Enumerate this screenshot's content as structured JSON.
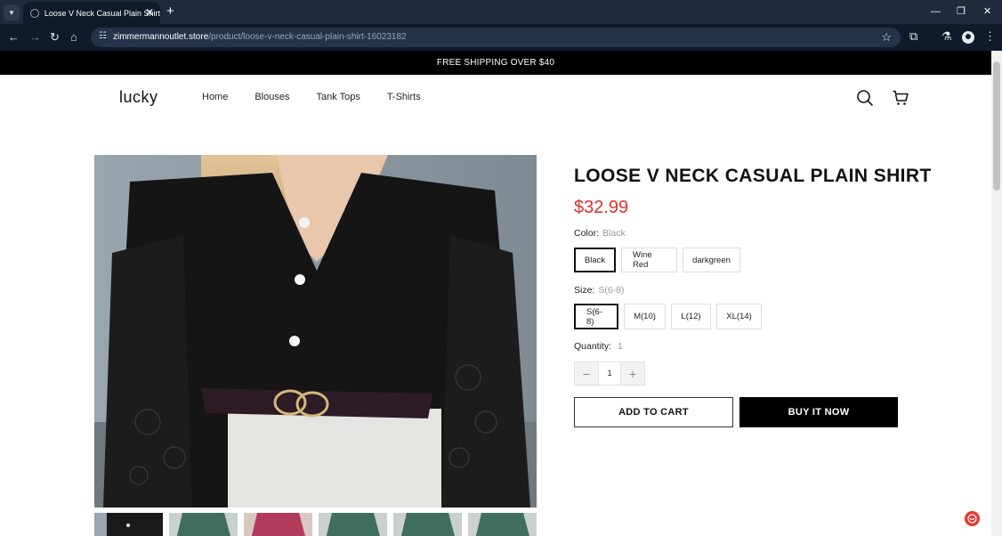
{
  "browser": {
    "tab_title": "Loose V Neck Casual Plain Shirt",
    "tab_close": "✕",
    "new_tab": "+",
    "url_host": "zimmermannoutlet.store",
    "url_path": "/product/loose-v-neck-casual-plain-shirt-16023182",
    "icons": [
      "tab-menu-icon",
      "back-icon",
      "forward-icon",
      "reload-icon",
      "home-icon",
      "site-info-icon",
      "star-icon",
      "extensions-icon",
      "labs-icon",
      "profile-icon",
      "more-icon",
      "minimize-icon",
      "maximize-icon",
      "close-window-icon"
    ]
  },
  "announcement": "FREE SHIPPING OVER $40",
  "header": {
    "logo": "lucky",
    "nav": [
      "Home",
      "Blouses",
      "Tank Tops",
      "T-Shirts"
    ]
  },
  "product": {
    "title": "LOOSE V NECK CASUAL PLAIN SHIRT",
    "price": "$32.99",
    "color_label": "Color:",
    "color_selected": "Black",
    "colors": [
      "Black",
      "Wine Red",
      "darkgreen"
    ],
    "size_label": "Size:",
    "size_selected": "S(6-8)",
    "sizes": [
      "S(6-8)",
      "M(10)",
      "L(12)",
      "XL(14)"
    ],
    "quantity_label": "Quantity:",
    "quantity_display": "1",
    "quantity_value": "1",
    "add_to_cart": "ADD TO CART",
    "buy_now": "BUY IT NOW",
    "thumbnail_colors": [
      "#1a1a1a",
      "#3f6f5c",
      "#b23a5c",
      "#3f6f5c",
      "#3f6f5c",
      "#3f6f5c"
    ]
  },
  "colors": {
    "price_red": "#d9302f",
    "chrome_dark": "#0f1b2b",
    "chrome_tabbar": "#1f2b3d"
  }
}
